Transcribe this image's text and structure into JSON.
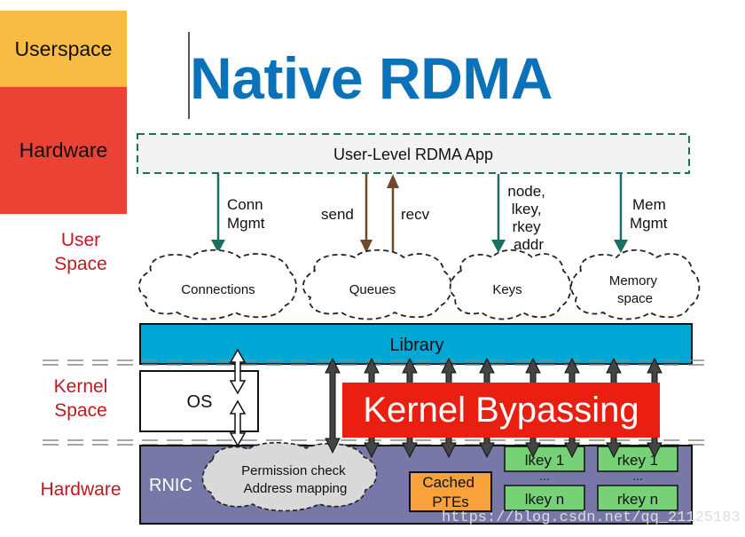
{
  "legend": {
    "userspace": "Userspace",
    "hardware": "Hardware"
  },
  "title": "Native RDMA",
  "side_labels": {
    "user_space": [
      "User",
      "Space"
    ],
    "kernel_space": [
      "Kernel",
      "Space"
    ],
    "hardware": "Hardware"
  },
  "app": {
    "label": "User-Level RDMA App"
  },
  "arrows": {
    "conn_mgmt": [
      "Conn",
      "Mgmt"
    ],
    "send": "send",
    "recv": "recv",
    "keys": [
      "node,",
      "lkey,",
      "rkey",
      "addr"
    ],
    "mem_mgmt": [
      "Mem",
      "Mgmt"
    ]
  },
  "clouds": {
    "connections": "Connections",
    "queues": "Queues",
    "keys": "Keys",
    "memory": [
      "Memory",
      "space"
    ]
  },
  "library": "Library",
  "os": "OS",
  "kernel_bypassing": "Kernel Bypassing",
  "rnic": {
    "label": "RNIC",
    "cloud": [
      "Permission check",
      "Address mapping"
    ],
    "cached": [
      "Cached",
      "PTEs"
    ],
    "lkey1": "lkey 1",
    "rkey1": "rkey 1",
    "dots": "...",
    "lkeyn": "lkey n",
    "rkeyn": "rkey n"
  },
  "colors": {
    "title": "#0b72b9",
    "teal": "#1b6f63",
    "brown": "#6e4a28",
    "library": "#00a8d6",
    "rnic": "#7777a8",
    "kernel_bypass": "#ea1f12",
    "key_green": "#77d277",
    "pte_orange": "#f9a13a"
  },
  "watermark": "https://blog.csdn.net/qq_21125183"
}
